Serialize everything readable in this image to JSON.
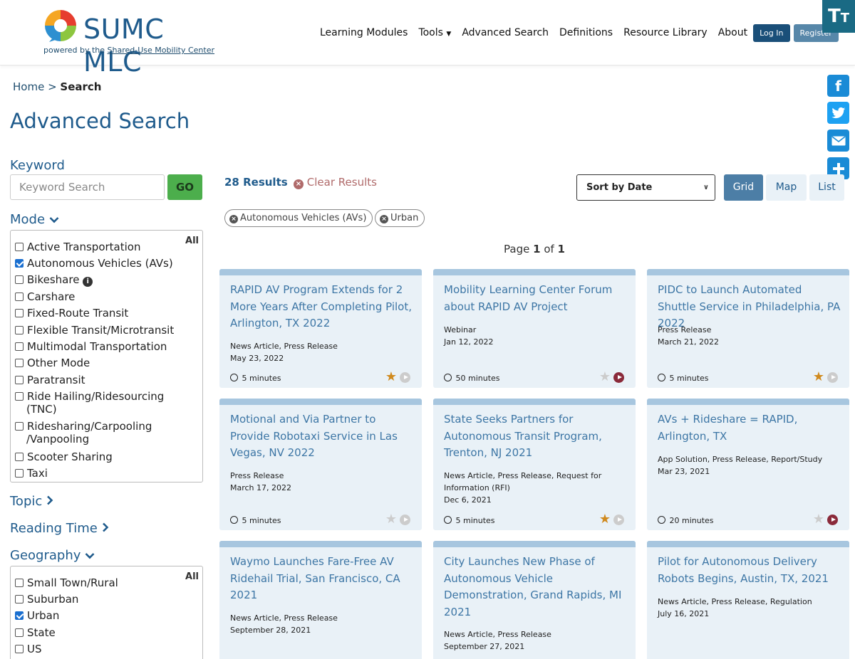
{
  "header": {
    "logo_text": "SUMC MLC",
    "powered_by": "powered by the ",
    "powered_link": "Shared-Use Mobility Center",
    "nav": [
      {
        "label": "Learning Modules"
      },
      {
        "label": "Tools"
      },
      {
        "label": "Advanced Search"
      },
      {
        "label": "Definitions"
      },
      {
        "label": "Resource Library"
      },
      {
        "label": "About"
      }
    ],
    "login_label": "Log In",
    "register_label": "Register",
    "text_size_label": "T"
  },
  "breadcrumb": {
    "home": "Home",
    "separator": " > ",
    "current": "Search"
  },
  "page_title": "Advanced Search",
  "sidebar": {
    "keyword_label": "Keyword",
    "keyword_placeholder": "Keyword Search",
    "go_label": "GO",
    "mode_label": "Mode",
    "all_label": "All",
    "mode_items": [
      {
        "label": "Active Transportation",
        "checked": false
      },
      {
        "label": "Autonomous Vehicles (AVs)",
        "checked": true
      },
      {
        "label": "Bikeshare",
        "checked": false
      },
      {
        "label": "Carshare",
        "checked": false
      },
      {
        "label": "Fixed-Route Transit",
        "checked": false
      },
      {
        "label": "Flexible Transit/Microtransit",
        "checked": false
      },
      {
        "label": "Multimodal Transportation",
        "checked": false
      },
      {
        "label": "Other Mode",
        "checked": false
      },
      {
        "label": "Paratransit",
        "checked": false
      },
      {
        "label": "Ride Hailing/Ridesourcing",
        "label2": "(TNC)",
        "checked": false
      },
      {
        "label": "Ridesharing/Carpooling",
        "label2": "/Vanpooling",
        "checked": false
      },
      {
        "label": "Scooter Sharing",
        "checked": false
      },
      {
        "label": "Taxi",
        "checked": false
      }
    ],
    "topic_label": "Topic",
    "reading_time_label": "Reading Time",
    "geography_label": "Geography",
    "geo_items": [
      {
        "label": "Small Town/Rural",
        "checked": false
      },
      {
        "label": "Suburban",
        "checked": false
      },
      {
        "label": "Urban",
        "checked": true
      },
      {
        "label": "State",
        "checked": false
      },
      {
        "label": "US",
        "checked": false
      }
    ]
  },
  "results": {
    "count_label": "28 Results",
    "clear_label": "Clear Results",
    "sort_value": "Sort by Date",
    "view_grid": "Grid",
    "view_map": "Map",
    "view_list": "List",
    "chips": [
      "Autonomous Vehicles (AVs)",
      "Urban"
    ],
    "page_prefix": "Page ",
    "page_current": "1",
    "page_of": " of ",
    "page_total": "1"
  },
  "cards": [
    {
      "title": "RAPID AV Program Extends for 2 More Years After Completing Pilot, Arlington, TX 2022",
      "type": "News Article, Press Release",
      "date": "May 23, 2022",
      "time": "5 minutes",
      "starred": true,
      "video": false
    },
    {
      "title": "Mobility Learning Center Forum about RAPID AV Project",
      "type": "Webinar",
      "date": "Jan 12, 2022",
      "time": "50 minutes",
      "starred": false,
      "video": true
    },
    {
      "title": "PIDC to Launch Automated Shuttle Service in Philadelphia, PA 2022",
      "type": "Press Release",
      "date": "March 21, 2022",
      "time": "5 minutes",
      "starred": true,
      "video": false
    },
    {
      "title": "Motional and Via Partner to Provide Robotaxi Service in Las Vegas, NV 2022",
      "type": "Press Release",
      "date": "March 17, 2022",
      "time": "5 minutes",
      "starred": false,
      "video": false
    },
    {
      "title": "State Seeks Partners for Autonomous Transit Program, Trenton, NJ 2021",
      "type": "News Article, Press Release, Request for Information (RFI)",
      "date": "Dec 6, 2021",
      "time": "5 minutes",
      "starred": true,
      "video": false
    },
    {
      "title": "AVs + Rideshare = RAPID, Arlington, TX",
      "type": "App Solution, Press Release, Report/Study",
      "date": "Mar 23, 2021",
      "time": "20 minutes",
      "starred": false,
      "video": true
    },
    {
      "title": "Waymo Launches Fare-Free AV Ridehail Trial, San Francisco, CA 2021",
      "type": "News Article, Press Release",
      "date": "September 28, 2021",
      "time": "",
      "starred": false,
      "video": false
    },
    {
      "title": "City Launches New Phase of Autonomous Vehicle Demonstration, Grand Rapids, MI 2021",
      "type": "News Article, Press Release",
      "date": "September 27, 2021",
      "time": "",
      "starred": false,
      "video": false
    },
    {
      "title": "Pilot for Autonomous Delivery Robots Begins, Austin, TX, 2021",
      "type": "News Article, Press Release, Regulation",
      "date": "July 16, 2021",
      "time": "",
      "starred": false,
      "video": false
    }
  ]
}
